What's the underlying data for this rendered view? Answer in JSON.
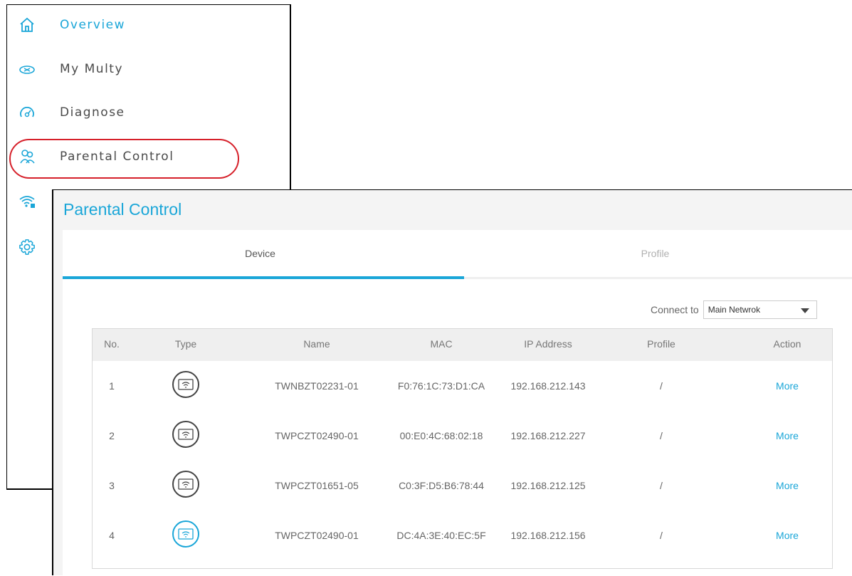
{
  "menu": {
    "items": [
      {
        "label": "Overview",
        "icon": "home-icon"
      },
      {
        "label": "My Multy",
        "icon": "multy-device-icon"
      },
      {
        "label": "Diagnose",
        "icon": "speedometer-icon"
      },
      {
        "label": "Parental Control",
        "icon": "parental-control-icon"
      },
      {
        "label": "",
        "icon": "wifi-lock-icon"
      },
      {
        "label": "",
        "icon": "gear-icon"
      }
    ]
  },
  "window": {
    "title": "Parental Control",
    "tabs": [
      {
        "label": "Device"
      },
      {
        "label": "Profile"
      }
    ],
    "connect_to": {
      "label": "Connect to",
      "value": "Main Netwrok"
    },
    "table": {
      "headers": [
        "No.",
        "Type",
        "Name",
        "MAC",
        "IP Address",
        "Profile",
        "Action"
      ],
      "rows": [
        {
          "no": "1",
          "name": "TWNBZT02231-01",
          "mac": "F0:76:1C:73:D1:CA",
          "ip": "192.168.212.143",
          "profile": "/",
          "action": "More",
          "status": "offline"
        },
        {
          "no": "2",
          "name": "TWPCZT02490-01",
          "mac": "00:E0:4C:68:02:18",
          "ip": "192.168.212.227",
          "profile": "/",
          "action": "More",
          "status": "offline"
        },
        {
          "no": "3",
          "name": "TWPCZT01651-05",
          "mac": "C0:3F:D5:B6:78:44",
          "ip": "192.168.212.125",
          "profile": "/",
          "action": "More",
          "status": "offline"
        },
        {
          "no": "4",
          "name": "TWPCZT02490-01",
          "mac": "DC:4A:3E:40:EC:5F",
          "ip": "192.168.212.156",
          "profile": "/",
          "action": "More",
          "status": "online"
        }
      ]
    }
  },
  "colors": {
    "accent": "#1aa6d8",
    "highlight": "#d6202a"
  }
}
